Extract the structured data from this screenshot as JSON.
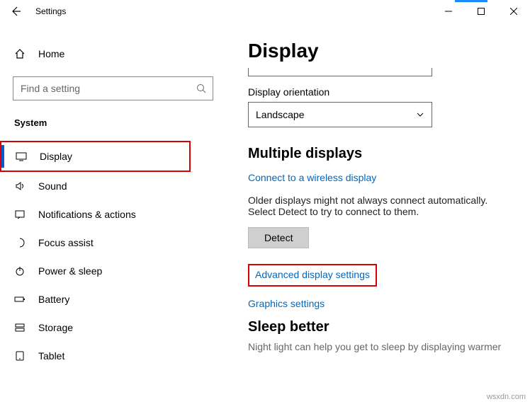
{
  "window": {
    "title": "Settings"
  },
  "sidebar": {
    "home": "Home",
    "search_placeholder": "Find a setting",
    "category": "System",
    "items": [
      {
        "label": "Display"
      },
      {
        "label": "Sound"
      },
      {
        "label": "Notifications & actions"
      },
      {
        "label": "Focus assist"
      },
      {
        "label": "Power & sleep"
      },
      {
        "label": "Battery"
      },
      {
        "label": "Storage"
      },
      {
        "label": "Tablet"
      }
    ]
  },
  "main": {
    "title": "Display",
    "orientation_label": "Display orientation",
    "orientation_value": "Landscape",
    "multi_title": "Multiple displays",
    "connect_link": "Connect to a wireless display",
    "hint": "Older displays might not always connect automatically. Select Detect to try to connect to them.",
    "detect_btn": "Detect",
    "advanced_link": "Advanced display settings",
    "graphics_link": "Graphics settings",
    "sleep_title": "Sleep better",
    "sleep_text": "Night light can help you get to sleep by displaying warmer"
  },
  "watermark": "wsxdn.com"
}
